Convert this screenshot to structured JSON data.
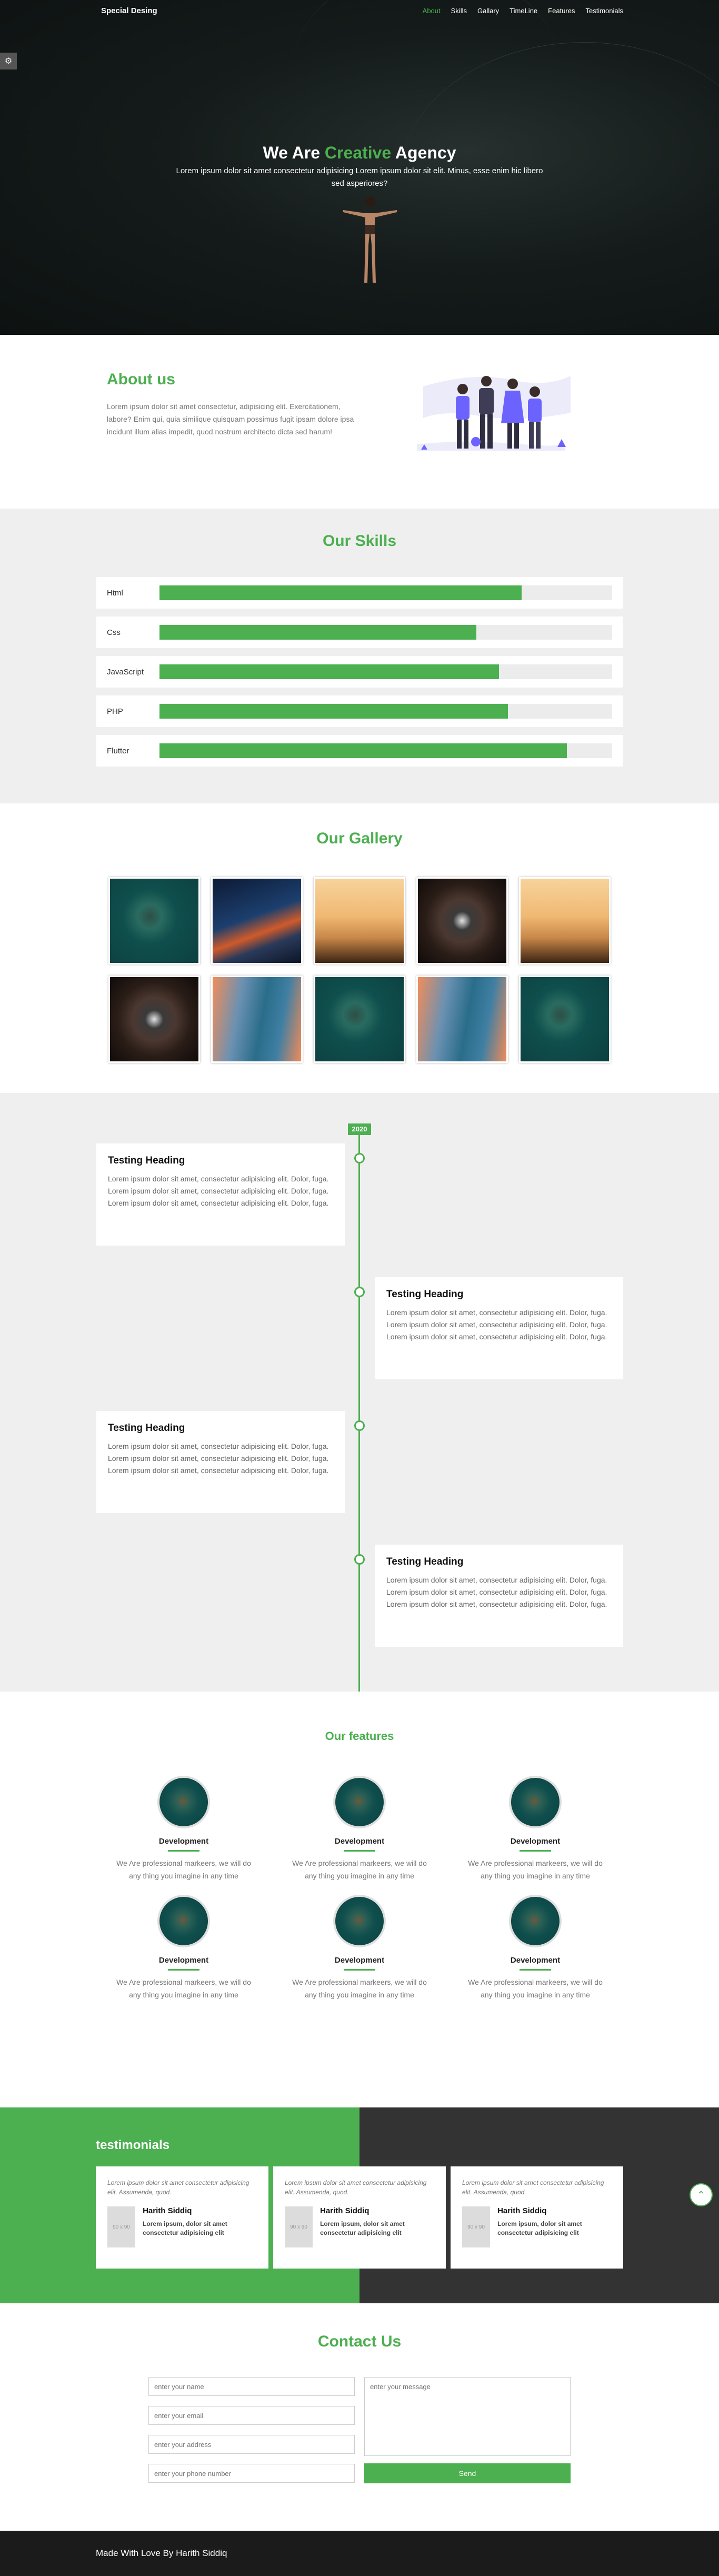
{
  "nav": {
    "brand": "Special Desing",
    "links": [
      "About",
      "Skills",
      "Gallary",
      "TimeLine",
      "Features",
      "Testimonials"
    ],
    "active_index": 0
  },
  "hero": {
    "settings_icon": "gear-icon",
    "title_before": "We Are ",
    "title_highlight": "Creative",
    "title_after": " Agency",
    "subtitle": "Lorem ipsum dolor sit amet consectetur adipisicing Lorem ipsum dolor sit elit. Minus, esse enim hic libero sed asperiores?"
  },
  "about": {
    "title": "About us",
    "text": "Lorem ipsum dolor sit amet consectetur, adipisicing elit. Exercitationem, labore? Enim qui, quia similique quisquam possimus fugit ipsam dolore ipsa incidunt illum alias impedit, quod nostrum architecto dicta sed harum!"
  },
  "skills": {
    "title": "Our Skills",
    "items": [
      {
        "name": "Html",
        "level": 80
      },
      {
        "name": "Css",
        "level": 70
      },
      {
        "name": "JavaScript",
        "level": 75
      },
      {
        "name": "PHP",
        "level": 77
      },
      {
        "name": "Flutter",
        "level": 90
      }
    ]
  },
  "gallery": {
    "title": "Our Gallery",
    "images": [
      "teal",
      "city",
      "balloon",
      "round",
      "balloon",
      "round",
      "canyon",
      "teal",
      "canyon",
      "teal"
    ]
  },
  "timeline": {
    "year": "2020",
    "items": [
      {
        "heading": "Testing Heading",
        "text": "Lorem ipsum dolor sit amet, consectetur adipisicing elit. Dolor, fuga. Lorem ipsum dolor sit amet, consectetur adipisicing elit. Dolor, fuga. Lorem ipsum dolor sit amet, consectetur adipisicing elit. Dolor, fuga."
      },
      {
        "heading": "Testing Heading",
        "text": "Lorem ipsum dolor sit amet, consectetur adipisicing elit. Dolor, fuga. Lorem ipsum dolor sit amet, consectetur adipisicing elit. Dolor, fuga. Lorem ipsum dolor sit amet, consectetur adipisicing elit. Dolor, fuga."
      },
      {
        "heading": "Testing Heading",
        "text": "Lorem ipsum dolor sit amet, consectetur adipisicing elit. Dolor, fuga. Lorem ipsum dolor sit amet, consectetur adipisicing elit. Dolor, fuga. Lorem ipsum dolor sit amet, consectetur adipisicing elit. Dolor, fuga."
      },
      {
        "heading": "Testing Heading",
        "text": "Lorem ipsum dolor sit amet, consectetur adipisicing elit. Dolor, fuga. Lorem ipsum dolor sit amet, consectetur adipisicing elit. Dolor, fuga. Lorem ipsum dolor sit amet, consectetur adipisicing elit. Dolor, fuga."
      }
    ]
  },
  "features": {
    "title": "Our features",
    "items": [
      {
        "title": "Development",
        "text": "We Are professional markeers, we will do any thing you imagine in any time"
      },
      {
        "title": "Development",
        "text": "We Are professional markeers, we will do any thing you imagine in any time"
      },
      {
        "title": "Development",
        "text": "We Are professional markeers, we will do any thing you imagine in any time"
      },
      {
        "title": "Development",
        "text": "We Are professional markeers, we will do any thing you imagine in any time"
      },
      {
        "title": "Development",
        "text": "We Are professional markeers, we will do any thing you imagine in any time"
      },
      {
        "title": "Development",
        "text": "We Are professional markeers, we will do any thing you imagine in any time"
      }
    ]
  },
  "testimonials": {
    "title": "testimonials",
    "items": [
      {
        "quote": "Lorem ipsum dolor sit amet consectetur adipisicing elit. Assumenda, quod.",
        "avatar": "90 x 90",
        "name": "Harith Siddiq",
        "desc": "Lorem ipsum, dolor sit amet consectetur adipisicing elit"
      },
      {
        "quote": "Lorem ipsum dolor sit amet consectetur adipisicing elit. Assumenda, quod.",
        "avatar": "90 x 90",
        "name": "Harith Siddiq",
        "desc": "Lorem ipsum, dolor sit amet consectetur adipisicing elit"
      },
      {
        "quote": "Lorem ipsum dolor sit amet consectetur adipisicing elit. Assumenda, quod.",
        "avatar": "90 x 90",
        "name": "Harith Siddiq",
        "desc": "Lorem ipsum, dolor sit amet consectetur adipisicing elit"
      }
    ],
    "scroll_top_icon": "chevron-up-icon"
  },
  "contact": {
    "title": "Contact Us",
    "name_placeholder": "enter your name",
    "email_placeholder": "enter your email",
    "address_placeholder": "enter your address",
    "phone_placeholder": "enter your phone number",
    "message_placeholder": "enter your message",
    "send_label": "Send"
  },
  "footer": {
    "text": "Made With Love By Harith Siddiq"
  },
  "colors": {
    "accent": "#4caf50",
    "dark": "#333333",
    "section_gray": "#efefef",
    "footer": "#1b1b1b"
  }
}
